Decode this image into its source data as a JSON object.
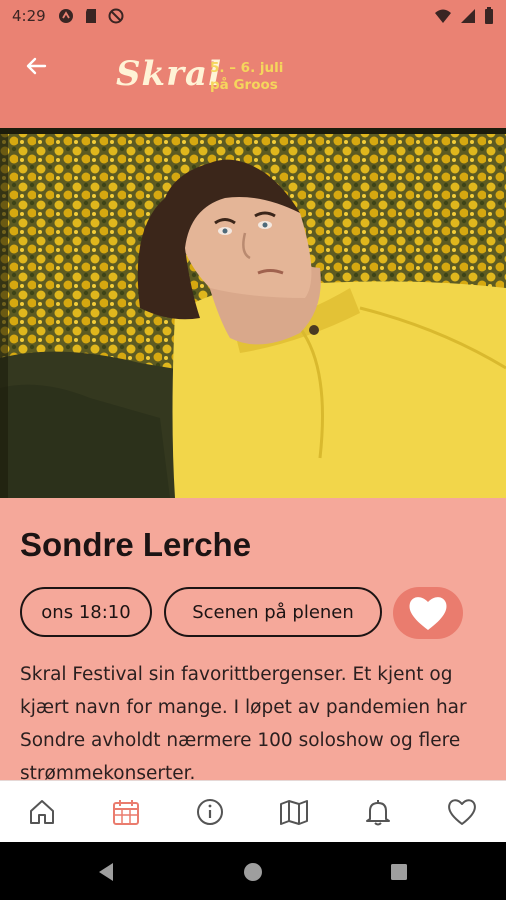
{
  "status_bar": {
    "time": "4:29",
    "left_icons": [
      "app-notification-icon",
      "sd-card-icon",
      "dnd-icon"
    ],
    "right_icons": [
      "wifi-icon",
      "signal-icon",
      "battery-icon"
    ]
  },
  "header": {
    "back_icon": "back-arrow-icon",
    "logo_text": "Skral",
    "date_line1": "5. – 6. juli",
    "date_line2": "på Groos"
  },
  "artist": {
    "name": "Sondre Lerche",
    "time": "ons 18:10",
    "stage": "Scenen på plenen",
    "description": "Skral Festival sin favorittbergenser. Et kjent og kjært navn for mange. I løpet av pandemien har Sondre avholdt nærmere 100 soloshow og flere strømmekonserter."
  },
  "bottom_nav": [
    {
      "icon": "home-icon",
      "active": false
    },
    {
      "icon": "calendar-icon",
      "active": true
    },
    {
      "icon": "info-icon",
      "active": false
    },
    {
      "icon": "map-icon",
      "active": false
    },
    {
      "icon": "bell-icon",
      "active": false
    },
    {
      "icon": "heart-icon",
      "active": false
    }
  ],
  "colors": {
    "header": "#ea8273",
    "content_bg": "#f5a89a",
    "accent": "#ea7c6e",
    "logo": "#fff3d6",
    "dates": "#f5d65c"
  }
}
